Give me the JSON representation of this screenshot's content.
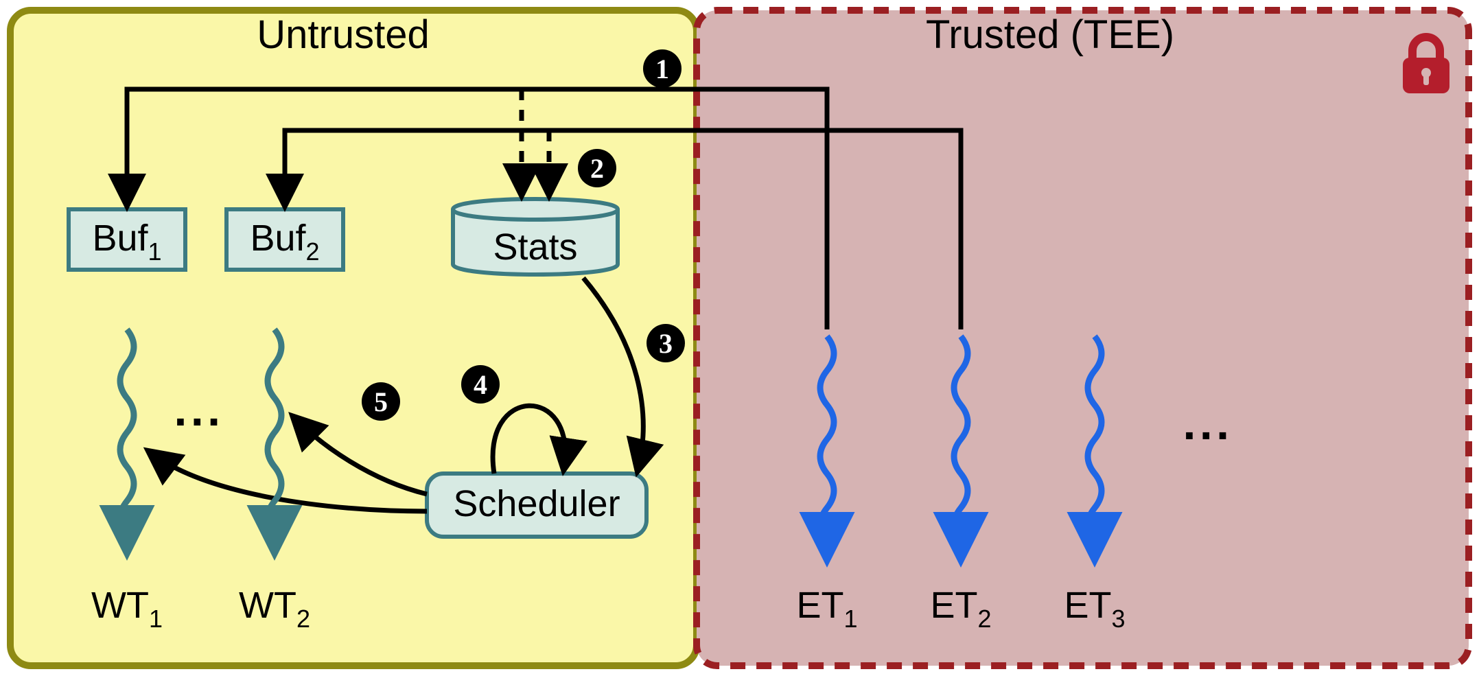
{
  "regions": {
    "untrusted_title": "Untrusted",
    "trusted_title": "Trusted (TEE)"
  },
  "boxes": {
    "buf1": {
      "base": "Buf",
      "sub": "1"
    },
    "buf2": {
      "base": "Buf",
      "sub": "2"
    },
    "stats": "Stats",
    "scheduler": "Scheduler"
  },
  "threads": {
    "wt1": {
      "base": "WT",
      "sub": "1"
    },
    "wt2": {
      "base": "WT",
      "sub": "2"
    },
    "et1": {
      "base": "ET",
      "sub": "1"
    },
    "et2": {
      "base": "ET",
      "sub": "2"
    },
    "et3": {
      "base": "ET",
      "sub": "3"
    }
  },
  "ellipsis": {
    "wt": "...",
    "et": "..."
  },
  "steps": {
    "s1": "1",
    "s2": "2",
    "s3": "3",
    "s4": "4",
    "s5": "5"
  },
  "colors": {
    "untrusted_fill": "#faf7a8",
    "untrusted_stroke": "#8e8a13",
    "trusted_fill": "#d6b3b3",
    "trusted_stroke": "#9b1f22",
    "box_fill": "#d7eae3",
    "box_stroke": "#3c7b82",
    "wt_thread": "#3c7b82",
    "et_thread": "#1f66e5",
    "lock": "#b41e2c"
  }
}
